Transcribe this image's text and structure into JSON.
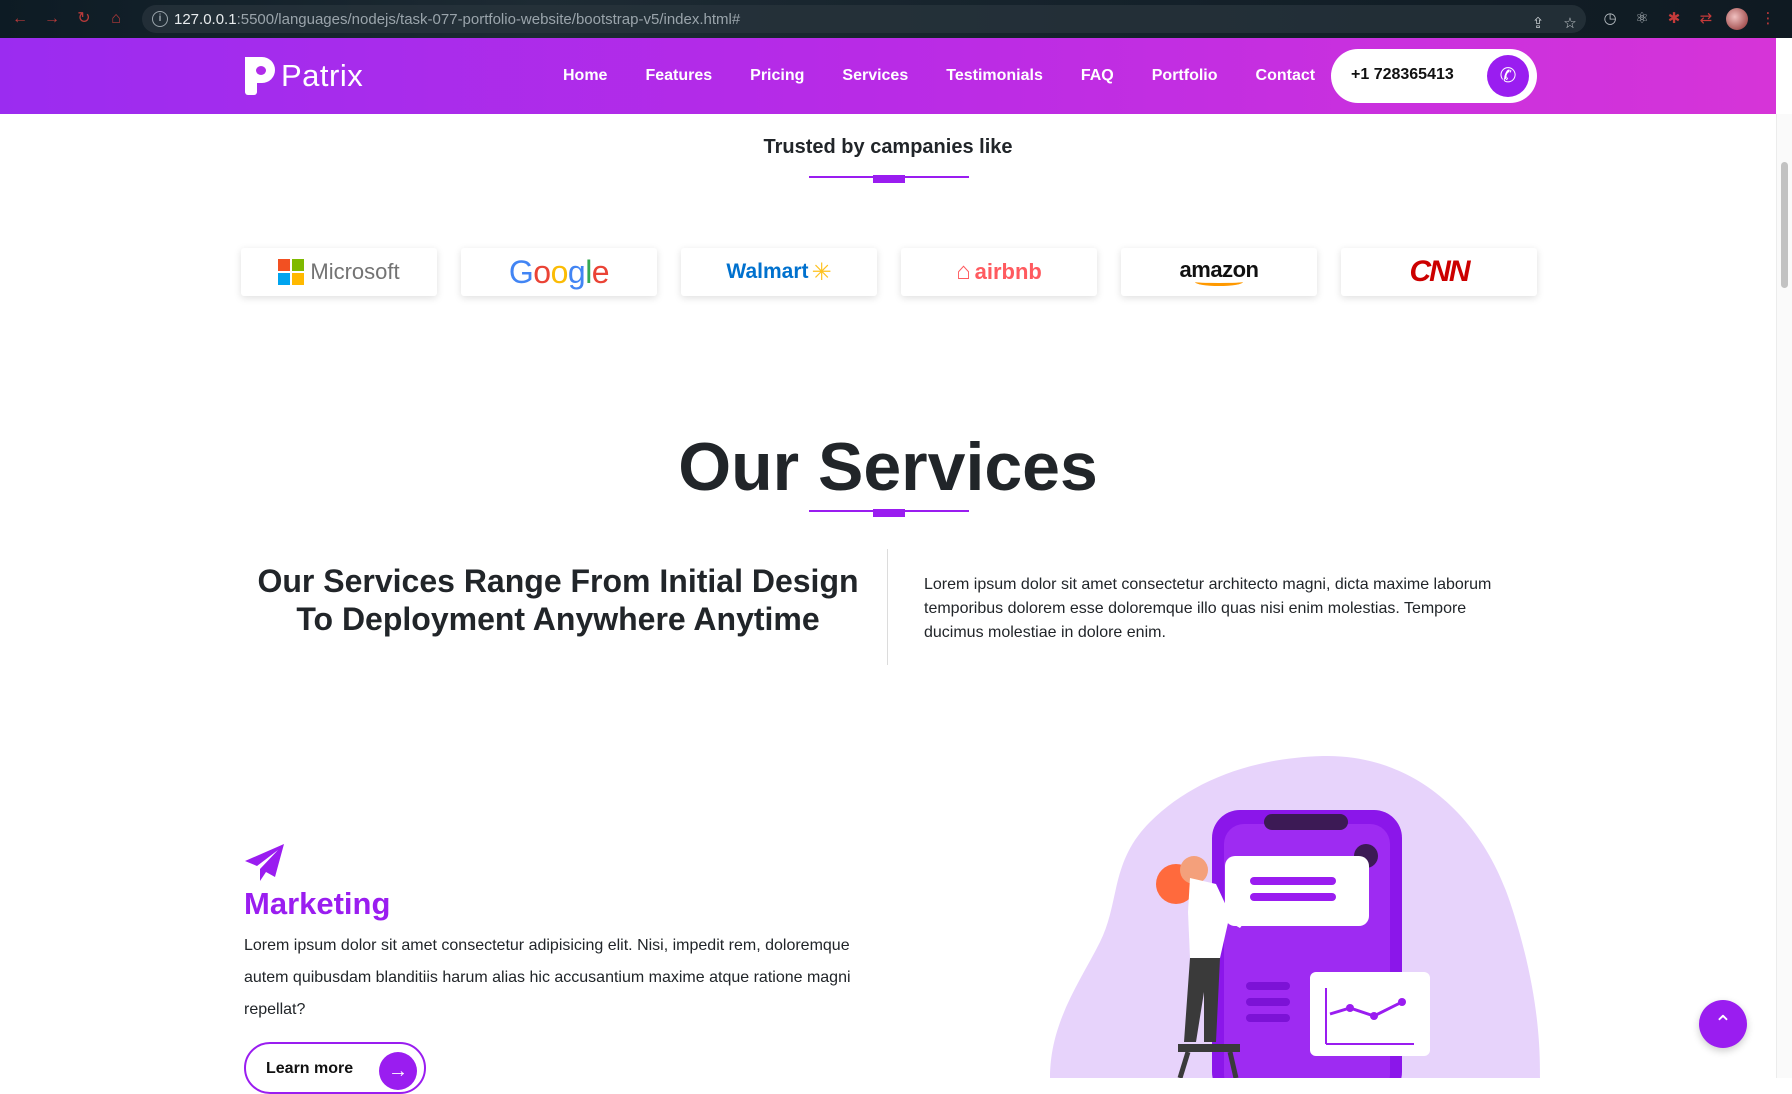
{
  "browser": {
    "url_host": "127.0.0.1",
    "url_path": ":5500/languages/nodejs/task-077-portfolio-website/bootstrap-v5/index.html#"
  },
  "header": {
    "brand": "Patrix",
    "nav": [
      "Home",
      "Features",
      "Pricing",
      "Services",
      "Testimonials",
      "FAQ",
      "Portfolio",
      "Contact"
    ],
    "phone": "+1 728365413"
  },
  "trusted": {
    "title": "Trusted by campanies like",
    "companies": [
      "Microsoft",
      "Google",
      "Walmart",
      "airbnb",
      "amazon",
      "CNN"
    ]
  },
  "services": {
    "title": "Our Services",
    "tagline_line1": "Our Services Range From Initial Design",
    "tagline_line2": "To Deployment Anywhere Anytime",
    "intro": "Lorem ipsum dolor sit amet consectetur architecto magni, dicta maxime laborum temporibus dolorem esse doloremque illo quas nisi enim molestias. Tempore ducimus molestiae in dolore enim."
  },
  "marketing": {
    "title": "Marketing",
    "body": "Lorem ipsum dolor sit amet consectetur adipisicing elit. Nisi, impedit rem, doloremque autem quibusdam blanditiis harum alias hic accusantium maxime atque ratione magni repellat?",
    "button": "Learn more"
  },
  "icons": {
    "back": "arrow-left-icon",
    "forward": "arrow-right-icon",
    "reload": "reload-icon",
    "home": "home-icon",
    "info": "info-icon",
    "share": "share-icon",
    "bookmark": "star-icon",
    "call": "phone-icon",
    "plane": "paper-plane-icon",
    "arrow": "arrow-right-icon",
    "top": "chevron-up-icon"
  },
  "colors": {
    "accent": "#9a1df0",
    "header_start": "#9b2cf0",
    "header_end": "#d634d8"
  }
}
